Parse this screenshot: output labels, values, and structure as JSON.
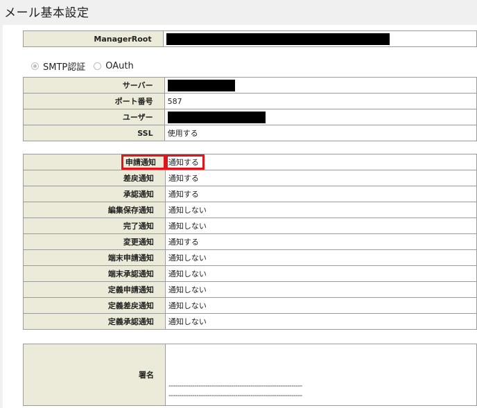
{
  "page": {
    "title": "メール基本設定"
  },
  "manager": {
    "label": "ManagerRoot"
  },
  "auth": {
    "options": [
      {
        "label": "SMTP認証",
        "checked": true
      },
      {
        "label": "OAuth",
        "checked": false
      }
    ]
  },
  "smtp": {
    "rows": [
      {
        "label": "サーバー",
        "value": ""
      },
      {
        "label": "ポート番号",
        "value": "587"
      },
      {
        "label": "ユーザー",
        "value": ""
      },
      {
        "label": "SSL",
        "value": "使用する"
      }
    ]
  },
  "notifications": {
    "rows": [
      {
        "label": "申請通知",
        "value": "通知する"
      },
      {
        "label": "差戻通知",
        "value": "通知する"
      },
      {
        "label": "承認通知",
        "value": "通知する"
      },
      {
        "label": "編集保存通知",
        "value": "通知しない"
      },
      {
        "label": "完了通知",
        "value": "通知しない"
      },
      {
        "label": "変更通知",
        "value": "通知する"
      },
      {
        "label": "端末申請通知",
        "value": "通知しない"
      },
      {
        "label": "端末承認通知",
        "value": "通知しない"
      },
      {
        "label": "定義申請通知",
        "value": "通知しない"
      },
      {
        "label": "定義差戻通知",
        "value": "通知しない"
      },
      {
        "label": "定義承認通知",
        "value": "通知しない"
      }
    ]
  },
  "signature": {
    "label": "署名",
    "lines": [
      "--------------------------------------------------------------",
      "--------------------------------------------------------------"
    ]
  },
  "colors": {
    "highlight": "#e1141b",
    "label_bg": "#ecead8",
    "redaction": "#000000"
  }
}
